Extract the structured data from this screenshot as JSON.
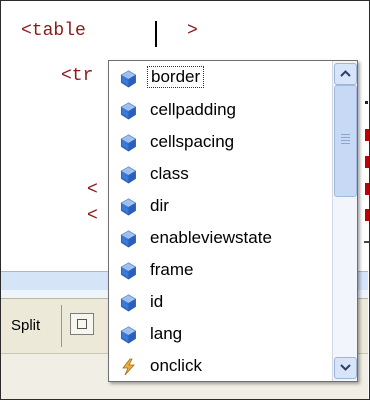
{
  "editor": {
    "line1_tag": "<table",
    "line1_close": ">",
    "line2_tag": "<tr",
    "line3_frag": "<",
    "line4_frag": "<"
  },
  "splitbar": {
    "label": "Split"
  },
  "completion": {
    "items": [
      {
        "label": "border",
        "icon": "property-icon",
        "selected": true
      },
      {
        "label": "cellpadding",
        "icon": "property-icon"
      },
      {
        "label": "cellspacing",
        "icon": "property-icon"
      },
      {
        "label": "class",
        "icon": "property-icon"
      },
      {
        "label": "dir",
        "icon": "property-icon"
      },
      {
        "label": "enableviewstate",
        "icon": "property-icon"
      },
      {
        "label": "frame",
        "icon": "property-icon"
      },
      {
        "label": "id",
        "icon": "property-icon"
      },
      {
        "label": "lang",
        "icon": "property-icon"
      },
      {
        "label": "onclick",
        "icon": "event-icon"
      }
    ]
  },
  "colors": {
    "tag": "#8b1a1a",
    "icon_blue": "#3a78d8",
    "event_icon": "#e0a030",
    "popup_border": "#6f6f6f"
  }
}
